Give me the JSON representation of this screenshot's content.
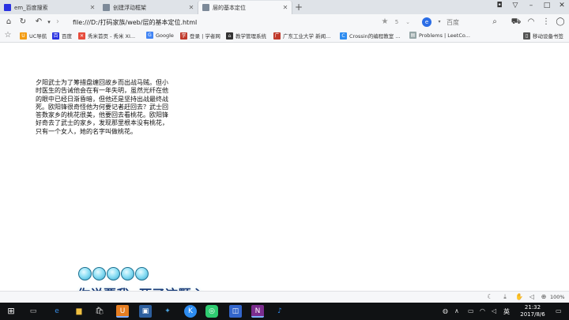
{
  "tabs": [
    {
      "label": "em_百度搜索",
      "icon": "baidu-icon",
      "color": "#2932e1"
    },
    {
      "label": "创建浮动框架",
      "icon": "page-icon",
      "color": "#7d8a99"
    },
    {
      "label": "层的基本定位",
      "icon": "page-icon",
      "color": "#7d8a99"
    }
  ],
  "toolbar": {
    "url": "file:///D:/打码家族/web/层的基本定位.html",
    "search_placeholder": "百度",
    "star_count": "5"
  },
  "bookmarks": [
    {
      "label": "UC导航",
      "icon": "uc-icon",
      "color": "#f39c12"
    },
    {
      "label": "百度",
      "icon": "baidu-icon",
      "color": "#2932e1"
    },
    {
      "label": "秀米首页 - 秀米 XI...",
      "icon": "xiumi-icon",
      "color": "#e74c3c"
    },
    {
      "label": "Google",
      "icon": "google-icon",
      "color": "#4285f4"
    },
    {
      "label": "登录 | 学者网",
      "icon": "scholar-icon",
      "color": "#c0392b"
    },
    {
      "label": "教学管理系统",
      "icon": "school-icon",
      "color": "#333333"
    },
    {
      "label": "广东工业大学 新闻...",
      "icon": "gdut-icon",
      "color": "#c0392b"
    },
    {
      "label": "Crossin的编程教室 ...",
      "icon": "crossin-icon",
      "color": "#2d8cf0"
    },
    {
      "label": "Problems | LeetCo...",
      "icon": "doc-icon",
      "color": "#95a5a6"
    },
    {
      "label": "移动设备书签",
      "icon": "mobile-icon",
      "color": "#555555"
    }
  ],
  "content": {
    "paragraph": "夕阳武士为了筹措盘缠回故乡而出战马贼。但小时医生的告诫他会在有一年失明，虽然光纤在他的眼中已经日渐昏暗，但他还是坚持出战最终战死。欧阳锋很奇怪他为何要记者赶回去？武士回答数家乡的桃花很美，他要回去看桃花。欧阳锋好奇去了武士的家乡，发现那里根本没有桃花，只有一个女人，她的名字叫做桃花。"
  },
  "overlay": {
    "lyrics": "你说要我  死了这颗心",
    "bubble_count": 5
  },
  "statusbar": {
    "zoom": "100%"
  },
  "taskbar": {
    "ime": "英",
    "time": "21:32",
    "date": "2017/8/6"
  }
}
